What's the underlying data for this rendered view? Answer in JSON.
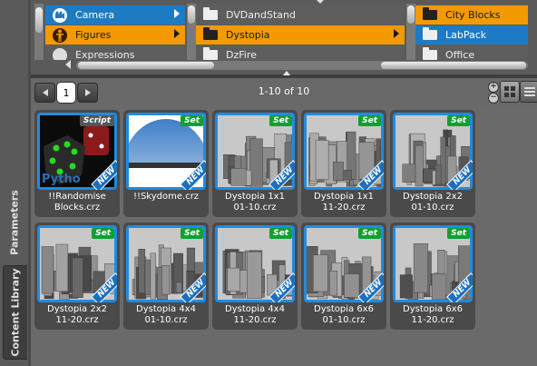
{
  "sidebar": {
    "tabs": [
      {
        "label": "Parameters"
      },
      {
        "label": "Content Library"
      }
    ]
  },
  "browser": {
    "col1": [
      {
        "label": "Camera",
        "state": "selected-blue",
        "icon": "camera-icon"
      },
      {
        "label": "Figures",
        "state": "selected-orange",
        "icon": "figure-icon"
      },
      {
        "label": "Expressions",
        "state": "normal",
        "icon": "expression-icon"
      }
    ],
    "col2": [
      {
        "label": "DVDandStand",
        "state": "normal"
      },
      {
        "label": "Dystopia",
        "state": "selected-orange"
      },
      {
        "label": "DzFire",
        "state": "normal"
      }
    ],
    "col3": [
      {
        "label": "City Blocks",
        "state": "selected-orange"
      },
      {
        "label": "LabPack",
        "state": "selected-blue"
      },
      {
        "label": "Office",
        "state": "normal"
      }
    ]
  },
  "toolbar": {
    "page_number": "1",
    "range_label": "1-10 of 10",
    "zoom_in": "+",
    "zoom_out": "−"
  },
  "items": [
    {
      "line1": "!!Randomise",
      "line2": "Blocks.crz",
      "badge": "Script",
      "is_new": true,
      "thumb": "python",
      "python_text": "Pytho"
    },
    {
      "line1": "!!Skydome.crz",
      "line2": "",
      "badge": "Set",
      "is_new": true,
      "thumb": "sky"
    },
    {
      "line1": "Dystopia 1x1",
      "line2": "01-10.crz",
      "badge": "Set",
      "is_new": true,
      "thumb": "city"
    },
    {
      "line1": "Dystopia 1x1",
      "line2": "11-20.crz",
      "badge": "Set",
      "is_new": true,
      "thumb": "city"
    },
    {
      "line1": "Dystopia 2x2",
      "line2": "01-10.crz",
      "badge": "Set",
      "is_new": true,
      "thumb": "city"
    },
    {
      "line1": "Dystopia 2x2",
      "line2": "11-20.crz",
      "badge": "Set",
      "is_new": true,
      "thumb": "city"
    },
    {
      "line1": "Dystopia 4x4",
      "line2": "01-10.crz",
      "badge": "Set",
      "is_new": true,
      "thumb": "city"
    },
    {
      "line1": "Dystopia 4x4",
      "line2": "11-20.crz",
      "badge": "Set",
      "is_new": true,
      "thumb": "city"
    },
    {
      "line1": "Dystopia 6x6",
      "line2": "01-10.crz",
      "badge": "Set",
      "is_new": true,
      "thumb": "city"
    },
    {
      "line1": "Dystopia 6x6",
      "line2": "11-20.crz",
      "badge": "Set",
      "is_new": true,
      "thumb": "city"
    }
  ],
  "new_label": "NEW",
  "colors": {
    "accent_blue": "#1d7bc4",
    "accent_orange": "#f29a00",
    "set_green": "#10a032",
    "panel_gray": "#6a6a6a"
  }
}
